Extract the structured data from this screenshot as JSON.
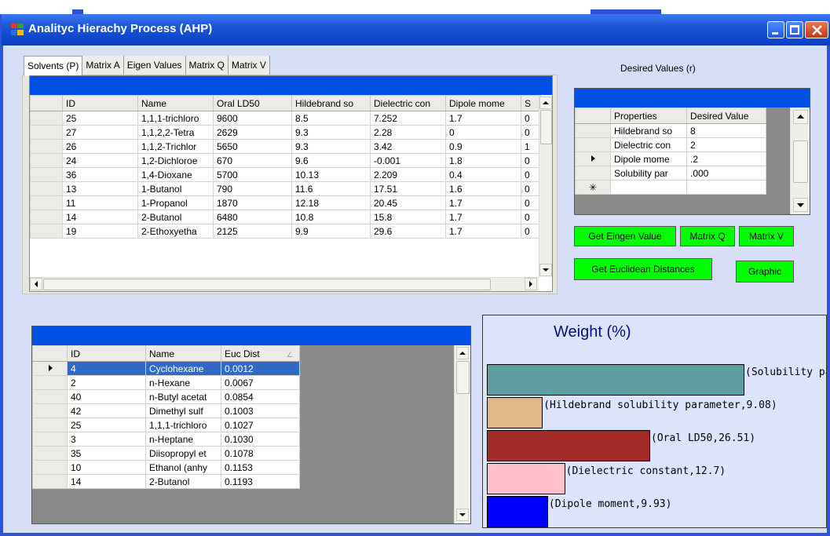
{
  "window": {
    "title": "Analityc Hierachy Process (AHP)"
  },
  "tabs": [
    {
      "label": "Solvents (P)",
      "active": true
    },
    {
      "label": "Matrix A"
    },
    {
      "label": "Eigen Values"
    },
    {
      "label": "Matrix Q"
    },
    {
      "label": "Matrix V"
    }
  ],
  "solvents_grid": {
    "columns": [
      "ID",
      "Name",
      "Oral LD50",
      "Hildebrand so",
      "Dielectric con",
      "Dipole mome",
      "S"
    ],
    "rows": [
      [
        "25",
        "1,1,1-trichloro",
        "9600",
        "8.5",
        "7.252",
        "1.7",
        "0"
      ],
      [
        "27",
        "1,1,2,2-Tetra",
        "2629",
        "9.3",
        "2.28",
        "0",
        "0"
      ],
      [
        "26",
        "1,1,2-Trichlor",
        "5650",
        "9.3",
        "3.42",
        "0.9",
        "1"
      ],
      [
        "24",
        "1,2-Dichloroe",
        "670",
        "9.6",
        "-0.001",
        "1.8",
        "0"
      ],
      [
        "36",
        "1,4-Dioxane",
        "5700",
        "10.13",
        "2.209",
        "0.4",
        "0"
      ],
      [
        "13",
        "1-Butanol",
        "790",
        "11.6",
        "17.51",
        "1.6",
        "0"
      ],
      [
        "11",
        "1-Propanol",
        "1870",
        "12.18",
        "20.45",
        "1.7",
        "0"
      ],
      [
        "14",
        "2-Butanol",
        "6480",
        "10.8",
        "15.8",
        "1.7",
        "0"
      ],
      [
        "19",
        "2-Ethoxyetha",
        "2125",
        "9.9",
        "29.6",
        "1.7",
        "0"
      ]
    ]
  },
  "desired": {
    "label": "Desired Values (r)",
    "columns": [
      "Properties",
      "Desired Value"
    ],
    "rows": [
      [
        "Hildebrand so",
        "8"
      ],
      [
        "Dielectric con",
        "2"
      ],
      [
        "Dipole mome",
        ".2"
      ],
      [
        "Solubility par",
        ".000"
      ]
    ]
  },
  "buttons": {
    "eigen": "Get  Eingen Value",
    "matrix_q": "Matrix Q",
    "matrix_v": "Matrix V",
    "euclid": "Get Euclidean Distances",
    "graphic": "Graphic"
  },
  "results_grid": {
    "columns": [
      "ID",
      "Name",
      "Euc Dist"
    ],
    "rows": [
      [
        "4",
        "Cyclohexane",
        "0.0012"
      ],
      [
        "2",
        "n-Hexane",
        "0.0067"
      ],
      [
        "40",
        "n-Butyl acetat",
        "0.0854"
      ],
      [
        "42",
        "Dimethyl sulf",
        "0.1003"
      ],
      [
        "25",
        "1,1,1-trichloro",
        "0.1027"
      ],
      [
        "3",
        "n-Heptane",
        "0.1030"
      ],
      [
        "35",
        "Diisopropyl et",
        "0.1078"
      ],
      [
        "10",
        "Ethanol (anhy",
        "0.1153"
      ],
      [
        "14",
        "2-Butanol",
        "0.1193"
      ]
    ]
  },
  "chart_data": {
    "type": "bar",
    "title": "Weight (%)",
    "series": [
      {
        "name": "Solubility par",
        "label": "(Solubility par",
        "value": null,
        "color": "#5f9ea0"
      },
      {
        "name": "Hildebrand solubility parameter",
        "label": "(Hildebrand solubility parameter,9.08)",
        "value": 9.08,
        "color": "#deb887"
      },
      {
        "name": "Oral LD50",
        "label": "(Oral LD50,26.51)",
        "value": 26.51,
        "color": "#a52a2a"
      },
      {
        "name": "Dielectric constant",
        "label": "(Dielectric constant,12.7)",
        "value": 12.7,
        "color": "#ffc0cb"
      },
      {
        "name": "Dipole moment",
        "label": "(Dipole moment,9.93)",
        "value": 9.93,
        "color": "#0000ff"
      }
    ]
  }
}
